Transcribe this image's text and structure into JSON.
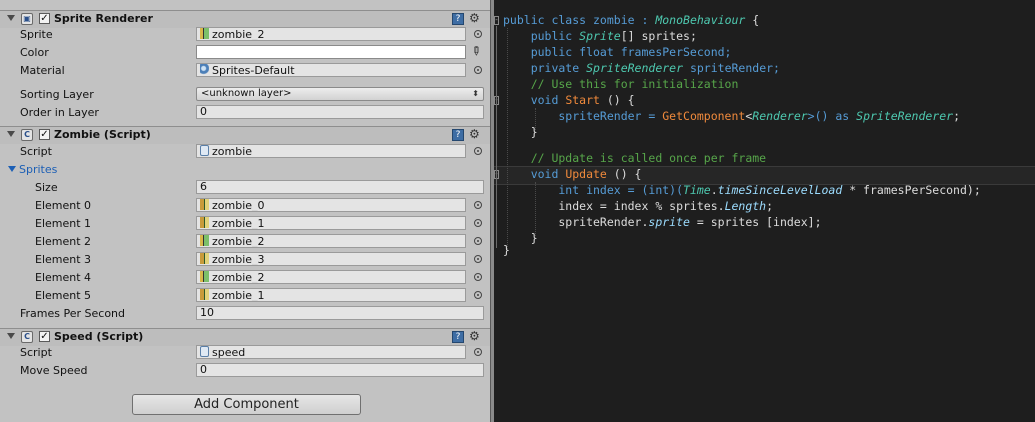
{
  "sprite_renderer": {
    "title": "Sprite Renderer",
    "sprite_label": "Sprite",
    "sprite_value": "zombie_2",
    "color_label": "Color",
    "color_value": "#ffffff",
    "material_label": "Material",
    "material_value": "Sprites-Default",
    "sorting_layer_label": "Sorting Layer",
    "sorting_layer_value": "<unknown layer>",
    "order_label": "Order in Layer",
    "order_value": "0"
  },
  "zombie_script": {
    "title": "Zombie (Script)",
    "script_label": "Script",
    "script_value": "zombie",
    "sprites_label": "Sprites",
    "size_label": "Size",
    "size_value": "6",
    "elements": [
      {
        "label": "Element 0",
        "value": "zombie_0"
      },
      {
        "label": "Element 1",
        "value": "zombie_1"
      },
      {
        "label": "Element 2",
        "value": "zombie_2"
      },
      {
        "label": "Element 3",
        "value": "zombie_3"
      },
      {
        "label": "Element 4",
        "value": "zombie_2"
      },
      {
        "label": "Element 5",
        "value": "zombie_1"
      }
    ],
    "fps_label": "Frames Per Second",
    "fps_value": "10"
  },
  "speed_script": {
    "title": "Speed (Script)",
    "script_label": "Script",
    "script_value": "speed",
    "move_speed_label": "Move Speed",
    "move_speed_value": "0"
  },
  "add_component_label": "Add Component",
  "code": {
    "l1": {
      "a": "public class zombie : ",
      "b": "MonoBehaviour",
      "c": " {"
    },
    "l2": {
      "a": "    public ",
      "b": "Sprite",
      "c": "[] sprites;"
    },
    "l3": {
      "a": "    public float framesPerSecond;"
    },
    "l4": {
      "a": "    private ",
      "b": "SpriteRenderer",
      "c": " spriteRender;"
    },
    "l5": {
      "a": "    // Use this for initialization"
    },
    "l6": {
      "a": "    void ",
      "b": "Start",
      "c": " () {"
    },
    "l7": {
      "a": "        spriteRender = ",
      "b": "GetComponent",
      "c": "<",
      "d": "Renderer",
      "e": ">() as ",
      "f": "SpriteRenderer",
      "g": ";"
    },
    "l8": {
      "a": "    }"
    },
    "l10": {
      "a": "    // Update is called once per frame"
    },
    "l11": {
      "a": "    void ",
      "b": "Update",
      "c": " () {"
    },
    "l12": {
      "a": "        int index = (int)(",
      "b": "Time",
      "c": ".",
      "d": "timeSinceLevelLoad",
      "e": " * framesPerSecond);"
    },
    "l13": {
      "a": "        index = index % sprites.",
      "b": "Length",
      "c": ";"
    },
    "l14": {
      "a": "        spriteRender.",
      "b": "sprite",
      "c": " = sprites [index];"
    },
    "l15": {
      "a": "    }"
    },
    "l16": {
      "a": "}"
    }
  }
}
